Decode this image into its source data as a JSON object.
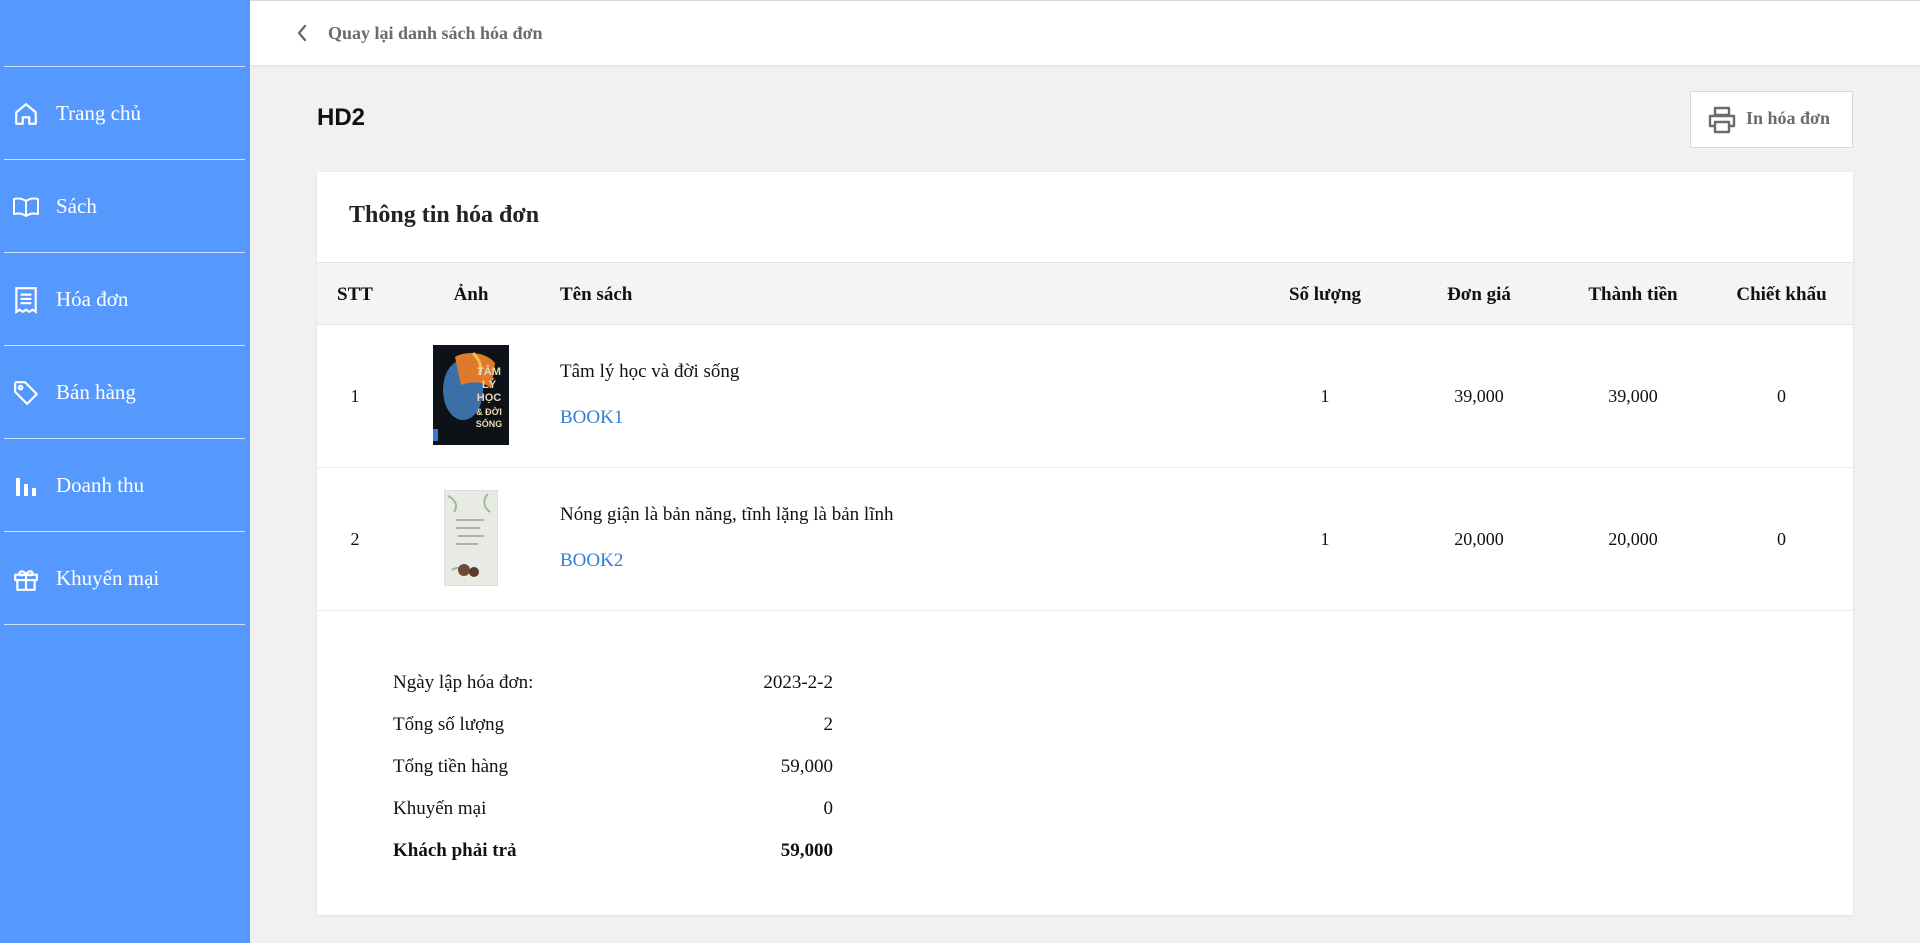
{
  "topbar": {
    "back_label": "Quay lại danh sách hóa đơn"
  },
  "sidebar": {
    "items": [
      {
        "label": "Trang chủ",
        "icon": "home-icon"
      },
      {
        "label": "Sách",
        "icon": "book-icon"
      },
      {
        "label": "Hóa đơn",
        "icon": "receipt-icon"
      },
      {
        "label": "Bán hàng",
        "icon": "tag-icon"
      },
      {
        "label": "Doanh thu",
        "icon": "bar-chart-icon"
      },
      {
        "label": "Khuyến mại",
        "icon": "gift-icon"
      }
    ]
  },
  "invoice": {
    "id": "HD2",
    "print_label": "In hóa đơn",
    "card_title": "Thông tin hóa đơn",
    "columns": [
      "STT",
      "Ảnh",
      "Tên sách",
      "Số lượng",
      "Đơn giá",
      "Thành tiền",
      "Chiết khấu"
    ],
    "rows": [
      {
        "stt": "1",
        "title": "Tâm lý học và đời sống",
        "code": "BOOK1",
        "qty": "1",
        "price": "39,000",
        "total": "39,000",
        "discount": "0",
        "cover_text": [
          "TÂM",
          "LÝ",
          "HỌC",
          "& ĐỜI",
          "SỐNG"
        ]
      },
      {
        "stt": "2",
        "title": "Nóng giận là bản năng, tĩnh lặng là bản lĩnh",
        "code": "BOOK2",
        "qty": "1",
        "price": "20,000",
        "total": "20,000",
        "discount": "0"
      }
    ],
    "summary": [
      {
        "label": "Ngày lập hóa đơn:",
        "value": "2023-2-2"
      },
      {
        "label": "Tổng số lượng",
        "value": "2"
      },
      {
        "label": "Tổng tiền hàng",
        "value": "59,000"
      },
      {
        "label": "Khuyến mại",
        "value": "0"
      },
      {
        "label": "Khách phải trả",
        "value": "59,000"
      }
    ]
  },
  "colors": {
    "sidebar": "#5599ff",
    "link": "#2f7fd3",
    "background": "#f1f1f1"
  }
}
